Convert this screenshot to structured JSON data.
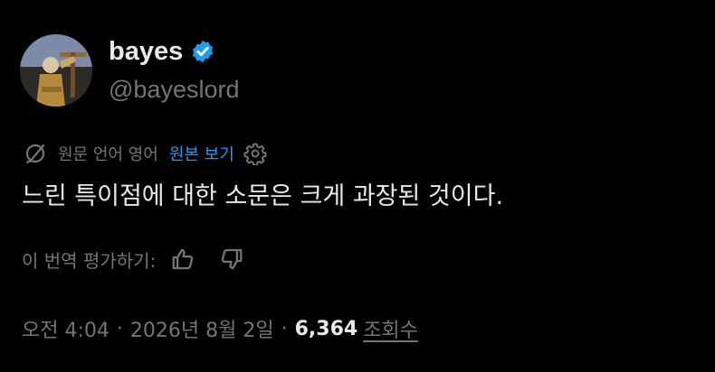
{
  "author": {
    "display_name": "bayes",
    "handle": "@bayeslord",
    "verified": true,
    "avatar_icon": "avatar-photo"
  },
  "translation": {
    "source_label": "원문 언어 영어",
    "show_original_label": "원본 보기",
    "globe_icon": "translate-icon",
    "settings_icon": "gear-icon"
  },
  "tweet": {
    "text": "느린 특이점에 대한 소문은 크게 과장된 것이다."
  },
  "rating": {
    "label": "이 번역 평가하기:",
    "thumbs_up_icon": "thumbs-up-icon",
    "thumbs_down_icon": "thumbs-down-icon"
  },
  "meta": {
    "time": "오전 4:04",
    "separator": "·",
    "date": "2026년 8월 2일",
    "views_count": "6,364",
    "views_label": "조회수"
  },
  "colors": {
    "background": "#000000",
    "text": "#e7e9ea",
    "muted": "#71767b",
    "accent": "#1d9bf0"
  }
}
